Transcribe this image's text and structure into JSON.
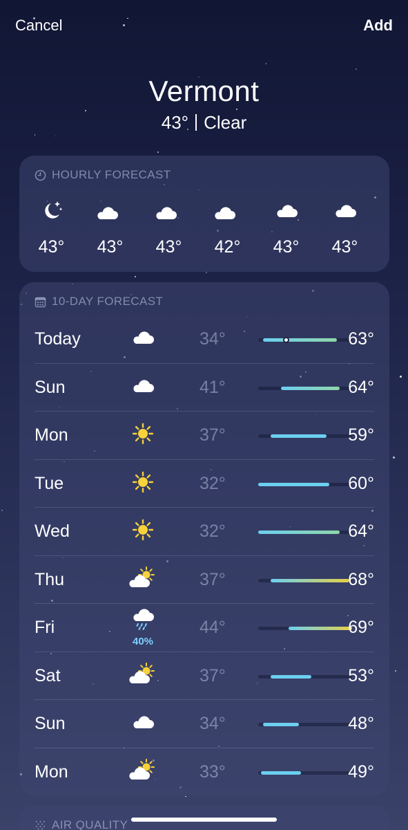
{
  "nav": {
    "cancel_label": "Cancel",
    "add_label": "Add"
  },
  "location": {
    "name": "Vermont",
    "current_temp": "43°",
    "condition": "Clear"
  },
  "hourly": {
    "header": "HOURLY FORECAST",
    "items": [
      {
        "icon": "moon-stars-icon",
        "temp": "43°"
      },
      {
        "icon": "cloud-moon-icon",
        "temp": "43°"
      },
      {
        "icon": "cloud-moon-icon",
        "temp": "43°"
      },
      {
        "icon": "cloud-moon-icon",
        "temp": "42°"
      },
      {
        "icon": "cloud-icon",
        "temp": "43°"
      },
      {
        "icon": "cloud-icon",
        "temp": "43°"
      }
    ]
  },
  "daily": {
    "header": "10-DAY FORECAST",
    "range_low": 32,
    "range_high": 69,
    "current_temp_value": 43,
    "rows": [
      {
        "day": "Today",
        "icon": "cloud-icon",
        "precip": "",
        "lo": "34°",
        "hi": "63°",
        "lo_val": 34,
        "hi_val": 63,
        "current": true
      },
      {
        "day": "Sun",
        "icon": "cloud-icon",
        "precip": "",
        "lo": "41°",
        "hi": "64°",
        "lo_val": 41,
        "hi_val": 64
      },
      {
        "day": "Mon",
        "icon": "sun-icon",
        "precip": "",
        "lo": "37°",
        "hi": "59°",
        "lo_val": 37,
        "hi_val": 59
      },
      {
        "day": "Tue",
        "icon": "sun-icon",
        "precip": "",
        "lo": "32°",
        "hi": "60°",
        "lo_val": 32,
        "hi_val": 60
      },
      {
        "day": "Wed",
        "icon": "sun-icon",
        "precip": "",
        "lo": "32°",
        "hi": "64°",
        "lo_val": 32,
        "hi_val": 64
      },
      {
        "day": "Thu",
        "icon": "partly-cloudy-icon",
        "precip": "",
        "lo": "37°",
        "hi": "68°",
        "lo_val": 37,
        "hi_val": 68
      },
      {
        "day": "Fri",
        "icon": "rain-cloud-icon",
        "precip": "40%",
        "lo": "44°",
        "hi": "69°",
        "lo_val": 44,
        "hi_val": 69
      },
      {
        "day": "Sat",
        "icon": "partly-cloudy-icon",
        "precip": "",
        "lo": "37°",
        "hi": "53°",
        "lo_val": 37,
        "hi_val": 53
      },
      {
        "day": "Sun",
        "icon": "cloud-icon",
        "precip": "",
        "lo": "34°",
        "hi": "48°",
        "lo_val": 34,
        "hi_val": 48
      },
      {
        "day": "Mon",
        "icon": "partly-cloudy-icon",
        "precip": "",
        "lo": "33°",
        "hi": "49°",
        "lo_val": 33,
        "hi_val": 49
      }
    ]
  },
  "air_quality": {
    "header": "AIR QUALITY"
  },
  "colors": {
    "bar_cool": "#6ccff0",
    "bar_mid": "#8fd6a8",
    "bar_warm": "#e6cf45",
    "sun": "#f7d23a",
    "precip": "#7dd0ff"
  }
}
